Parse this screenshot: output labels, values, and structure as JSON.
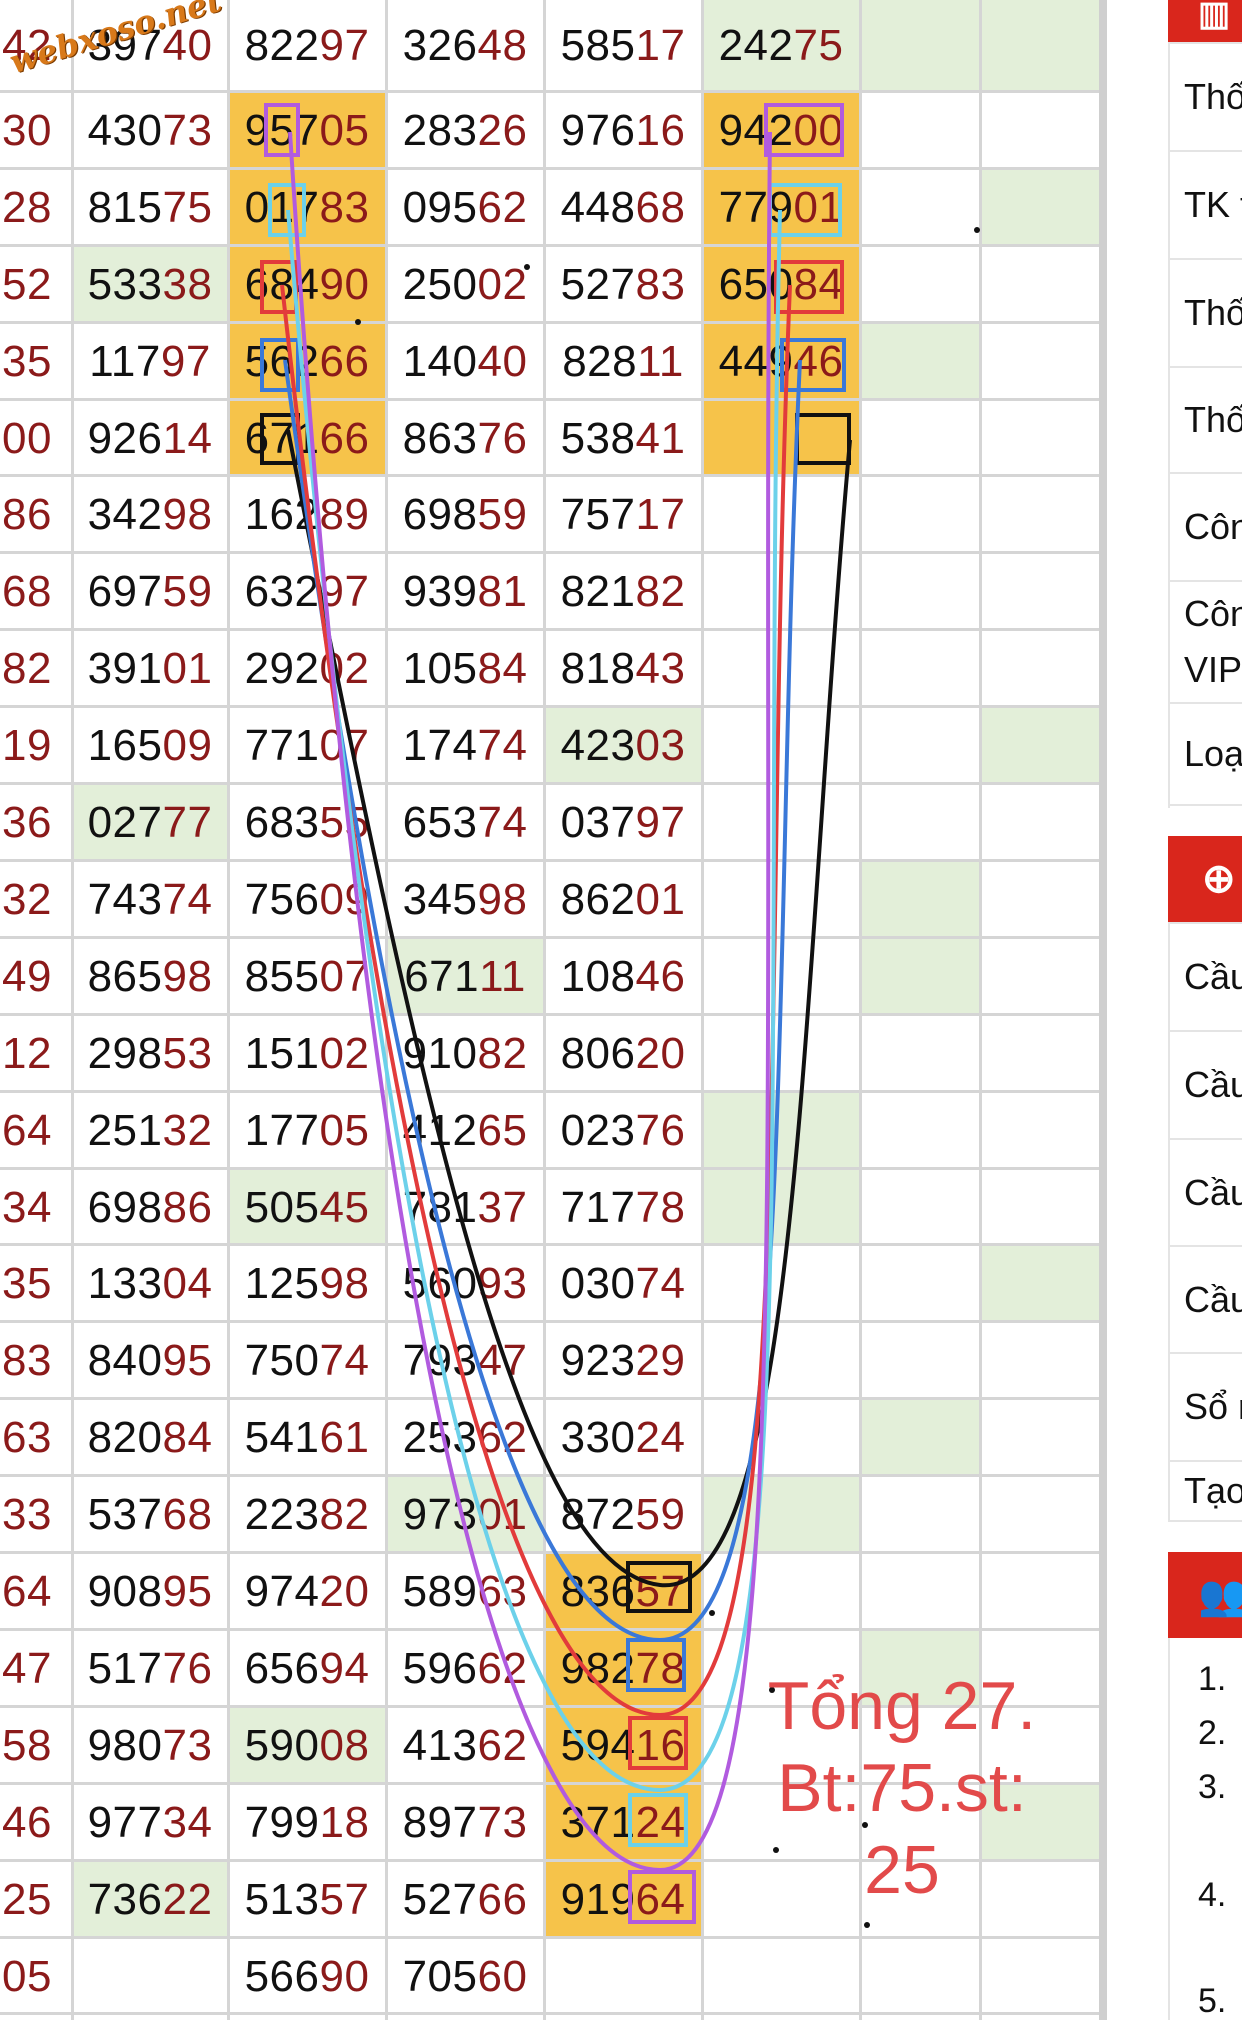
{
  "watermark": "webxoso.net",
  "rows": [
    {
      "c0": "42",
      "c1": "39740",
      "c2": "82297",
      "c3": "32648",
      "c4": "58517",
      "c5": "24275"
    },
    {
      "c0": "30",
      "c1": "43073",
      "c2": "95705",
      "c3": "28326",
      "c4": "97616",
      "c5": "94200"
    },
    {
      "c0": "28",
      "c1": "81575",
      "c2": "01783",
      "c3": "09562",
      "c4": "44868",
      "c5": "77901"
    },
    {
      "c0": "52",
      "c1": "53338",
      "c2": "68490",
      "c3": "25002",
      "c4": "52783",
      "c5": "65084"
    },
    {
      "c0": "35",
      "c1": "11797",
      "c2": "56266",
      "c3": "14040",
      "c4": "82811",
      "c5": "44946"
    },
    {
      "c0": "00",
      "c1": "92614",
      "c2": "67166",
      "c3": "86376",
      "c4": "53841",
      "c5": ""
    },
    {
      "c0": "86",
      "c1": "34298",
      "c2": "16289",
      "c3": "69859",
      "c4": "75717",
      "c5": ""
    },
    {
      "c0": "68",
      "c1": "69759",
      "c2": "63297",
      "c3": "93981",
      "c4": "82182",
      "c5": ""
    },
    {
      "c0": "82",
      "c1": "39101",
      "c2": "29202",
      "c3": "10584",
      "c4": "81843",
      "c5": ""
    },
    {
      "c0": "19",
      "c1": "16509",
      "c2": "77107",
      "c3": "17474",
      "c4": "42303",
      "c5": ""
    },
    {
      "c0": "36",
      "c1": "02777",
      "c2": "68355",
      "c3": "65374",
      "c4": "03797",
      "c5": ""
    },
    {
      "c0": "32",
      "c1": "74374",
      "c2": "75609",
      "c3": "34598",
      "c4": "86201",
      "c5": ""
    },
    {
      "c0": "49",
      "c1": "86598",
      "c2": "85507",
      "c3": "67111",
      "c4": "10846",
      "c5": ""
    },
    {
      "c0": "12",
      "c1": "29853",
      "c2": "15102",
      "c3": "91082",
      "c4": "80620",
      "c5": ""
    },
    {
      "c0": "64",
      "c1": "25132",
      "c2": "17705",
      "c3": "41265",
      "c4": "02376",
      "c5": ""
    },
    {
      "c0": "34",
      "c1": "69886",
      "c2": "50545",
      "c3": "78137",
      "c4": "71778",
      "c5": ""
    },
    {
      "c0": "35",
      "c1": "13304",
      "c2": "12598",
      "c3": "56093",
      "c4": "03074",
      "c5": ""
    },
    {
      "c0": "83",
      "c1": "84095",
      "c2": "75074",
      "c3": "79347",
      "c4": "92329",
      "c5": ""
    },
    {
      "c0": "63",
      "c1": "82084",
      "c2": "54161",
      "c3": "25362",
      "c4": "33024",
      "c5": ""
    },
    {
      "c0": "33",
      "c1": "53768",
      "c2": "22382",
      "c3": "97301",
      "c4": "87259",
      "c5": ""
    },
    {
      "c0": "64",
      "c1": "90895",
      "c2": "97420",
      "c3": "58963",
      "c4": "83657",
      "c5": ""
    },
    {
      "c0": "47",
      "c1": "51776",
      "c2": "65694",
      "c3": "59662",
      "c4": "98278",
      "c5": ""
    },
    {
      "c0": "58",
      "c1": "98073",
      "c2": "59008",
      "c3": "41362",
      "c4": "59416",
      "c5": ""
    },
    {
      "c0": "46",
      "c1": "97734",
      "c2": "79918",
      "c3": "89773",
      "c4": "37124",
      "c5": ""
    },
    {
      "c0": "25",
      "c1": "73622",
      "c2": "51357",
      "c3": "52766",
      "c4": "91964",
      "c5": ""
    },
    {
      "c0": "05",
      "c1": "",
      "c2": "56690",
      "c3": "70560",
      "c4": "",
      "c5": ""
    }
  ],
  "greenCells": [
    [
      3,
      1
    ],
    [
      9,
      4
    ],
    [
      10,
      1
    ],
    [
      15,
      2
    ],
    [
      12,
      3
    ],
    [
      0,
      5
    ],
    [
      2,
      7
    ],
    [
      4,
      6
    ],
    [
      9,
      7
    ],
    [
      11,
      6
    ],
    [
      14,
      5
    ],
    [
      15,
      5
    ],
    [
      16,
      7
    ],
    [
      18,
      6
    ],
    [
      19,
      3
    ],
    [
      19,
      5
    ],
    [
      22,
      2
    ],
    [
      23,
      7
    ],
    [
      24,
      1
    ],
    [
      21,
      6
    ],
    [
      0,
      6
    ],
    [
      0,
      7
    ],
    [
      12,
      6
    ]
  ],
  "orangeCells": [
    [
      1,
      2
    ],
    [
      2,
      2
    ],
    [
      3,
      2
    ],
    [
      4,
      2
    ],
    [
      5,
      2
    ],
    [
      1,
      5
    ],
    [
      2,
      5
    ],
    [
      3,
      5
    ],
    [
      4,
      5
    ],
    [
      5,
      5
    ],
    [
      20,
      4
    ],
    [
      21,
      4
    ],
    [
      22,
      4
    ],
    [
      23,
      4
    ],
    [
      24,
      4
    ]
  ],
  "annotation": {
    "line1": "Tổng 27.",
    "line2": "Bt:75.st:",
    "line3": "25"
  },
  "curveColors": {
    "purple": "#b15bdf",
    "cyan": "#6cd1ea",
    "red": "#e23b3b",
    "blue": "#3a78d8",
    "black": "#111111"
  },
  "sidebar": {
    "items1": [
      "Thố",
      "TK t",
      "Thố",
      "Thố",
      "Côn"
    ],
    "item_two_line": {
      "l1": "Côn",
      "l2": "VIP"
    },
    "item_last1": "Loạ",
    "items2": [
      "Cầu",
      "Cầu",
      "Cầu",
      "Cầu",
      "Sổ r",
      "Tạo"
    ],
    "list_numbers": [
      "1.",
      "2.",
      "3.",
      "4.",
      "5."
    ],
    "header_icons": {
      "h1": "stats-icon",
      "h2": "zoom-in-icon",
      "h3": "users-icon"
    }
  }
}
